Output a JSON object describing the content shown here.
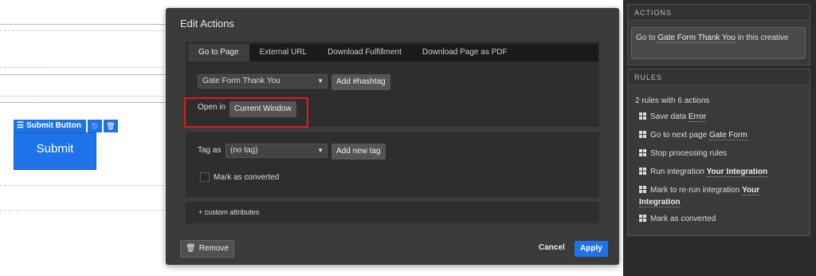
{
  "canvas": {
    "widget_label": "Submit Button",
    "submit_label": "Submit"
  },
  "modal": {
    "title": "Edit Actions",
    "tabs": [
      "Go to Page",
      "External URL",
      "Download Fulfillment",
      "Download Page as PDF"
    ],
    "page_select": "Gate Form Thank You",
    "add_hashtag": "Add #hashtag",
    "open_in_label": "Open in",
    "open_in_value": "Current Window",
    "tag_as_label": "Tag as",
    "tag_select": "(no tag)",
    "add_new_tag": "Add new tag",
    "mark_as_converted": "Mark as converted",
    "custom_attributes": "+ custom attributes",
    "remove": "Remove",
    "cancel": "Cancel",
    "apply": "Apply"
  },
  "sidebar": {
    "actions_header": "ACTIONS",
    "action_card": {
      "prefix": "Go to",
      "target": "Gate Form Thank You",
      "suffix": "in this creative"
    },
    "rules_header": "RULES",
    "rules_summary": "2 rules with 6 actions",
    "rules": [
      {
        "text": "Save data",
        "value": "Error"
      },
      {
        "text": "Go to next page",
        "value": "Gate Form"
      },
      {
        "text": "Stop processing rules",
        "value": ""
      },
      {
        "text": "Run integration",
        "value": "Your Integration"
      },
      {
        "text": "Mark to re-run integration",
        "value": "Your Integration"
      },
      {
        "text": "Mark as converted",
        "value": ""
      }
    ]
  },
  "colors": {
    "accent": "#1e73e8",
    "highlight": "#e01b1b",
    "modal_bg": "#3b3b3b"
  }
}
